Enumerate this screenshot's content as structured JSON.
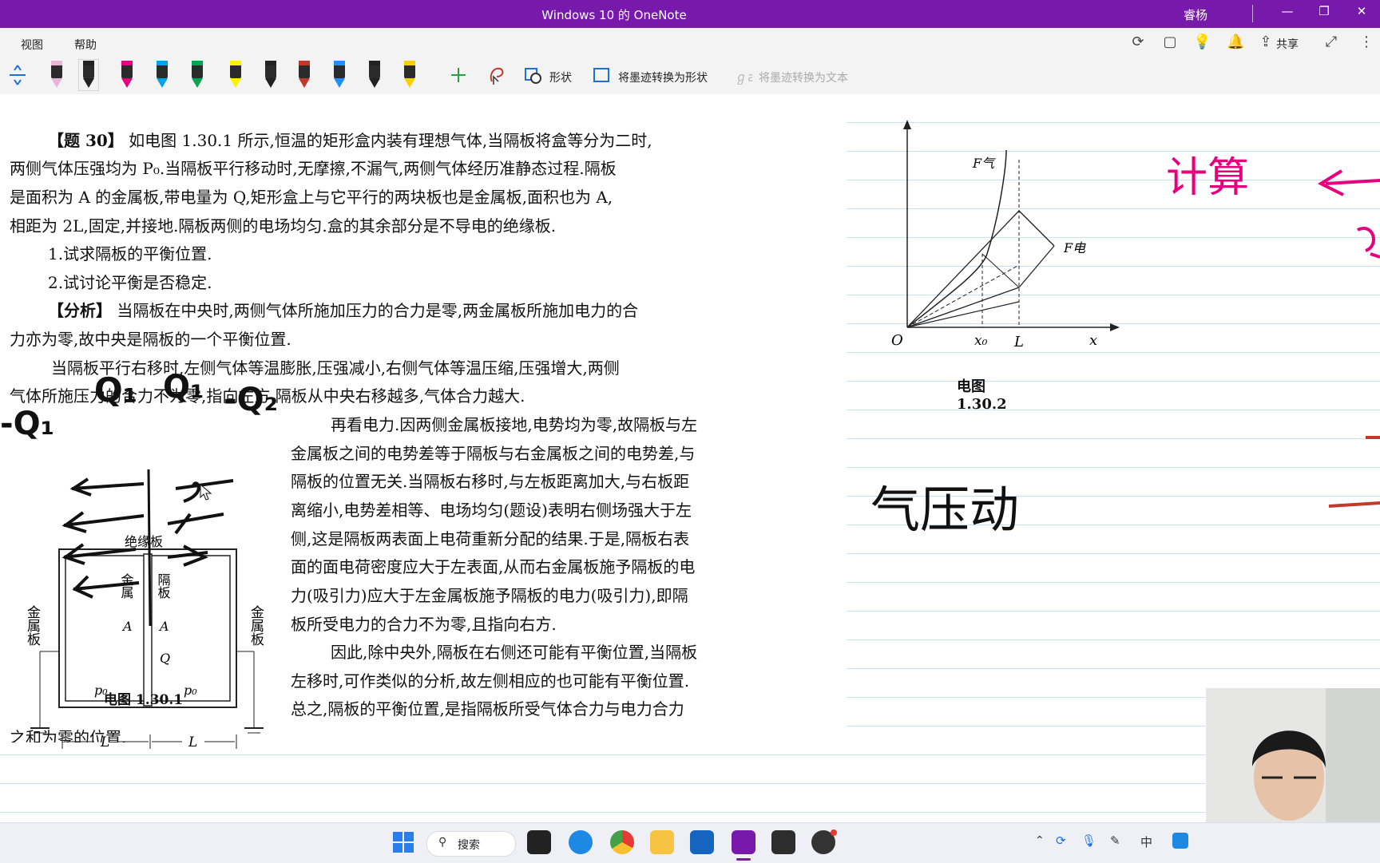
{
  "window": {
    "title": "Windows 10 的 OneNote",
    "user": "睿杨"
  },
  "menu": {
    "items": [
      "视图",
      "帮助"
    ],
    "share_label": "共享"
  },
  "toolbar": {
    "pens": [
      {
        "color": "#e8b4d8"
      },
      {
        "color": "#222222"
      },
      {
        "color": "#e6007e"
      },
      {
        "color": "#00a2e8"
      },
      {
        "color": "#00a651"
      },
      {
        "color": "#fff200"
      },
      {
        "color": "#222222"
      },
      {
        "color": "#c0392b"
      },
      {
        "color": "#1e90ff"
      },
      {
        "color": "#222222"
      },
      {
        "color": "#f7d000"
      }
    ],
    "shapes_label": "形状",
    "ink_to_shape_label": "将墨迹转换为形状",
    "ink_to_text_label": "将墨迹转换为文本"
  },
  "document": {
    "p1_tag": "【题 30】",
    "p1_l1": "如电图 1.30.1 所示,恒温的矩形盒内装有理想气体,当隔板将盒等分为二时,",
    "p1_l2": "两侧气体压强均为 P₀.当隔板平行移动时,无摩擦,不漏气,两侧气体经历准静态过程.隔板",
    "p1_l3": "是面积为 A 的金属板,带电量为 Q,矩形盒上与它平行的两块板也是金属板,面积也为 A,",
    "p1_l4": "相距为 2L,固定,并接地.隔板两侧的电场均匀.盒的其余部分是不导电的绝缘板.",
    "q1": "1.试求隔板的平衡位置.",
    "q2": "2.试讨论平衡是否稳定.",
    "a_tag": "【分析】",
    "a_l1": "当隔板在中央时,两侧气体所施加压力的合力是零,两金属板所施加电力的合",
    "a_l2": "力亦为零,故中央是隔板的一个平衡位置.",
    "b_l1": "当隔板平行右移时,左侧气体等温膨胀,压强减小,右侧气体等温压缩,压强增大,两侧",
    "b_l2": "气体所施压力的合力不为零,指向左方.隔板从中央右移越多,气体合力越大.",
    "c_l1": "再看电力.因两侧金属板接地,电势均为零,故隔板与左",
    "c_l2": "金属板之间的电势差等于隔板与右金属板之间的电势差,与",
    "c_l3": "隔板的位置无关.当隔板右移时,与左板距离加大,与右板距",
    "c_l4": "离缩小,电势差相等、电场均匀(题设)表明右侧场强大于左",
    "c_l5": "侧,这是隔板两表面上电荷重新分配的结果.于是,隔板右表",
    "c_l6": "面的面电荷密度应大于左表面,从而右金属板施予隔板的电",
    "c_l7": "力(吸引力)应大于左金属板施予隔板的电力(吸引力),即隔",
    "c_l8": "板所受电力的合力不为零,且指向右方.",
    "d_l1": "因此,除中央外,隔板在右侧还可能有平衡位置,当隔板",
    "d_l2": "左移时,可作类似的分析,故左侧相应的也可能有平衡位置.",
    "d_l3": "总之,隔板的平衡位置,是指隔板所受气体合力与电力合力",
    "d_l4": "之和为零的位置."
  },
  "figure1": {
    "caption": "电图 1.30.1",
    "insulator": "绝缘板",
    "left_plate": "金属板",
    "right_plate": "金属板",
    "left_mid": "金属",
    "right_mid": "隔板",
    "a1": "A",
    "a2": "A",
    "q": "Q",
    "p1": "p₀",
    "p2": "p₀",
    "len1": "L",
    "len2": "L"
  },
  "figure2": {
    "caption": "电图 1.30.2",
    "f_gas": "F气",
    "f_elec": "F电",
    "origin": "O",
    "x0": "x₀",
    "L": "L",
    "x": "x"
  },
  "handwriting": {
    "q_left": "-Q₁",
    "q_mid1": "Q₁",
    "q_mid2": "Q₁",
    "q_right": "-Q₂",
    "calc": "计算",
    "note": "气压动"
  },
  "taskbar": {
    "search_label": "搜索"
  }
}
